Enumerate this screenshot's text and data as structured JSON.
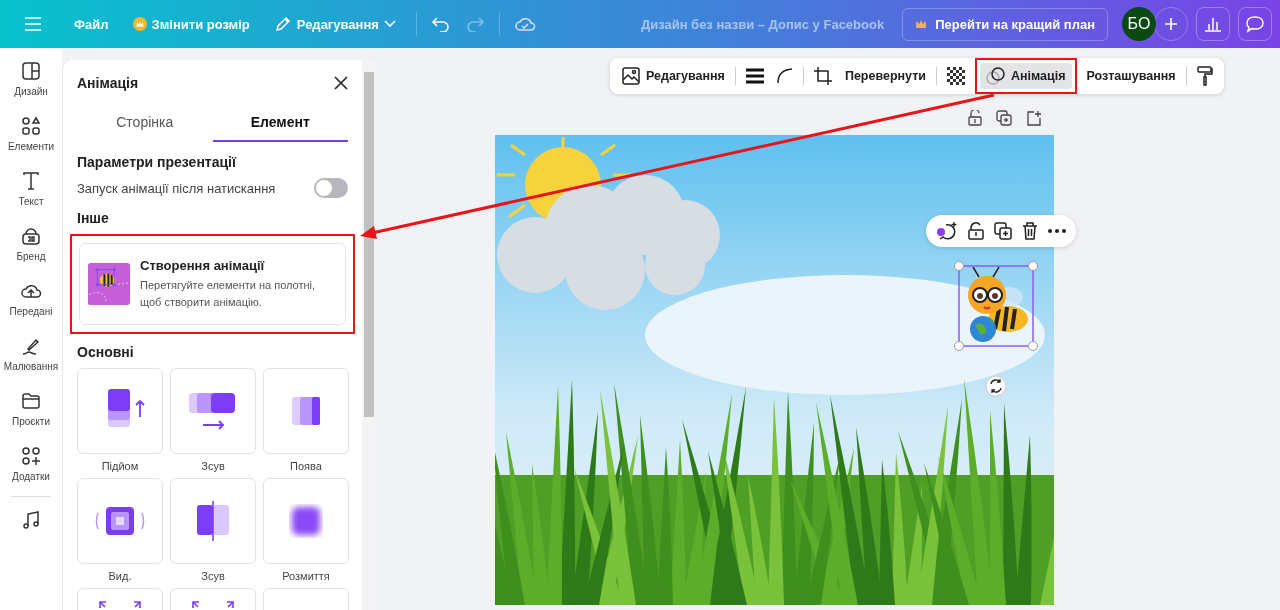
{
  "topbar": {
    "items": [
      {
        "label": "Файл",
        "kind": "text"
      },
      {
        "label": "Змінити розмір",
        "kind": "crown"
      },
      {
        "label": "Редагування",
        "kind": "dropdown"
      }
    ],
    "title": "Дизайн без назви – Допис у Facebook",
    "upgrade": "Перейти на кращий план",
    "avatar": "БО"
  },
  "rail": {
    "items": [
      {
        "label": "Дизайн",
        "kind": "design"
      },
      {
        "label": "Елементи",
        "kind": "elements"
      },
      {
        "label": "Текст",
        "kind": "text"
      },
      {
        "label": "Бренд",
        "kind": "brand"
      },
      {
        "label": "Передані",
        "kind": "uploads"
      },
      {
        "label": "Малювання",
        "kind": "draw"
      },
      {
        "label": "Проєкти",
        "kind": "projects"
      },
      {
        "label": "Додатки",
        "kind": "apps"
      },
      {
        "kind": "music"
      }
    ]
  },
  "panel": {
    "title": "Анімація",
    "tabs": [
      {
        "label": "Сторінка",
        "selected": false
      },
      {
        "label": "Елемент",
        "selected": true
      }
    ],
    "presentation_heading": "Параметри презентації",
    "toggle": {
      "label": "Запуск анімації після натискання",
      "on": false
    },
    "other_heading": "Інше",
    "create_card": {
      "title": "Створення анімації",
      "description": "Перетягуйте елементи на полотні, щоб створити анімацію.",
      "highlighted": true
    },
    "basic_heading": "Основні",
    "effects": [
      {
        "label": "Підйом",
        "kind": "rise"
      },
      {
        "label": "Зсув",
        "kind": "pan"
      },
      {
        "label": "Поява",
        "kind": "fade"
      },
      {
        "label": "Вид.",
        "kind": "pop"
      },
      {
        "label": "Зсув",
        "kind": "wipe"
      },
      {
        "label": "Розмиття",
        "kind": "blur"
      },
      {
        "kind": "expand"
      },
      {
        "kind": "expand"
      },
      {
        "kind": "blank"
      }
    ]
  },
  "toolbar": {
    "items": [
      {
        "kind": "image-edit",
        "label": "Редагування"
      },
      {
        "kind": "divider"
      },
      {
        "kind": "border"
      },
      {
        "kind": "corner"
      },
      {
        "kind": "divider"
      },
      {
        "kind": "crop"
      },
      {
        "kind": "text",
        "label": "Перевернути"
      },
      {
        "kind": "divider"
      },
      {
        "kind": "transparency"
      },
      {
        "kind": "animate",
        "label": "Анімація",
        "selected": true,
        "highlighted": true
      },
      {
        "kind": "text",
        "label": "Розташування"
      },
      {
        "kind": "divider"
      },
      {
        "kind": "paint"
      }
    ]
  }
}
